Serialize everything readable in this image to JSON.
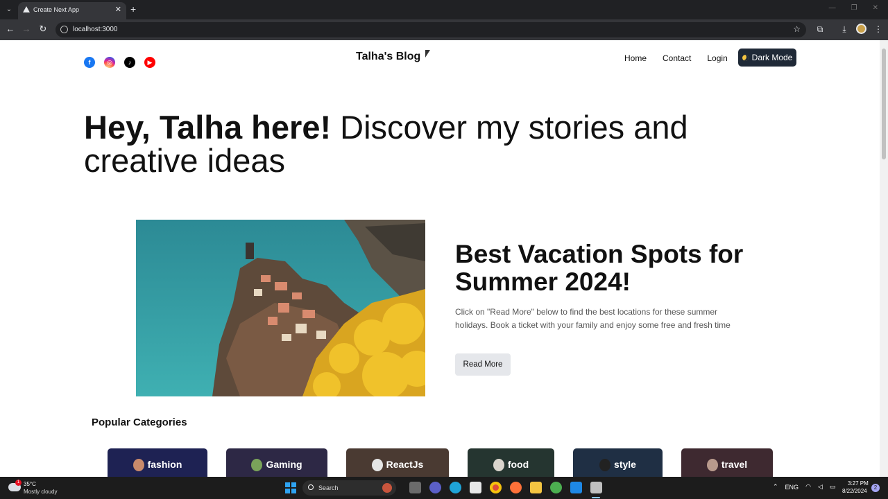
{
  "browser": {
    "tab_title": "Create Next App",
    "tab_close": "✕",
    "new_tab": "+",
    "url": "localhost:3000",
    "window_controls": [
      "—",
      "❐",
      "✕"
    ]
  },
  "header": {
    "logo": "Talha's Blog",
    "socials": [
      {
        "name": "facebook",
        "glyph": "f"
      },
      {
        "name": "instagram",
        "glyph": "◎"
      },
      {
        "name": "tiktok",
        "glyph": "♪"
      },
      {
        "name": "youtube",
        "glyph": "▶"
      }
    ],
    "nav": [
      "Home",
      "Contact",
      "Login"
    ],
    "dark_mode_label": "Dark Mode"
  },
  "hero": {
    "bold": "Hey, Talha here!",
    "rest": " Discover my stories and creative ideas"
  },
  "featured": {
    "title": "Best Vacation Spots for Summer 2024!",
    "description": "Click on \"Read More\" below to find the best locations for these summer holidays. Book a ticket with your family and enjoy some free and fresh time",
    "button": "Read More"
  },
  "categories": {
    "heading": "Popular Categories",
    "items": [
      {
        "label": "fashion",
        "color": "#1e2253",
        "avatar": "#c98a6b"
      },
      {
        "label": "Gaming",
        "color": "#2d2845",
        "avatar": "#7aa35a"
      },
      {
        "label": "ReactJs",
        "color": "#4a3a32",
        "avatar": "#e5e5e5"
      },
      {
        "label": "food",
        "color": "#253530",
        "avatar": "#d9d4cc"
      },
      {
        "label": "style",
        "color": "#1f2f44",
        "avatar": "#222222"
      },
      {
        "label": "travel",
        "color": "#3e2930",
        "avatar": "#b89a8c"
      }
    ]
  },
  "taskbar": {
    "weather_temp": "35°C",
    "weather_desc": "Mostly cloudy",
    "weather_badge": "1",
    "search_placeholder": "Search",
    "language": "ENG",
    "time": "3:27 PM",
    "date": "8/22/2024",
    "notifications": "2"
  }
}
